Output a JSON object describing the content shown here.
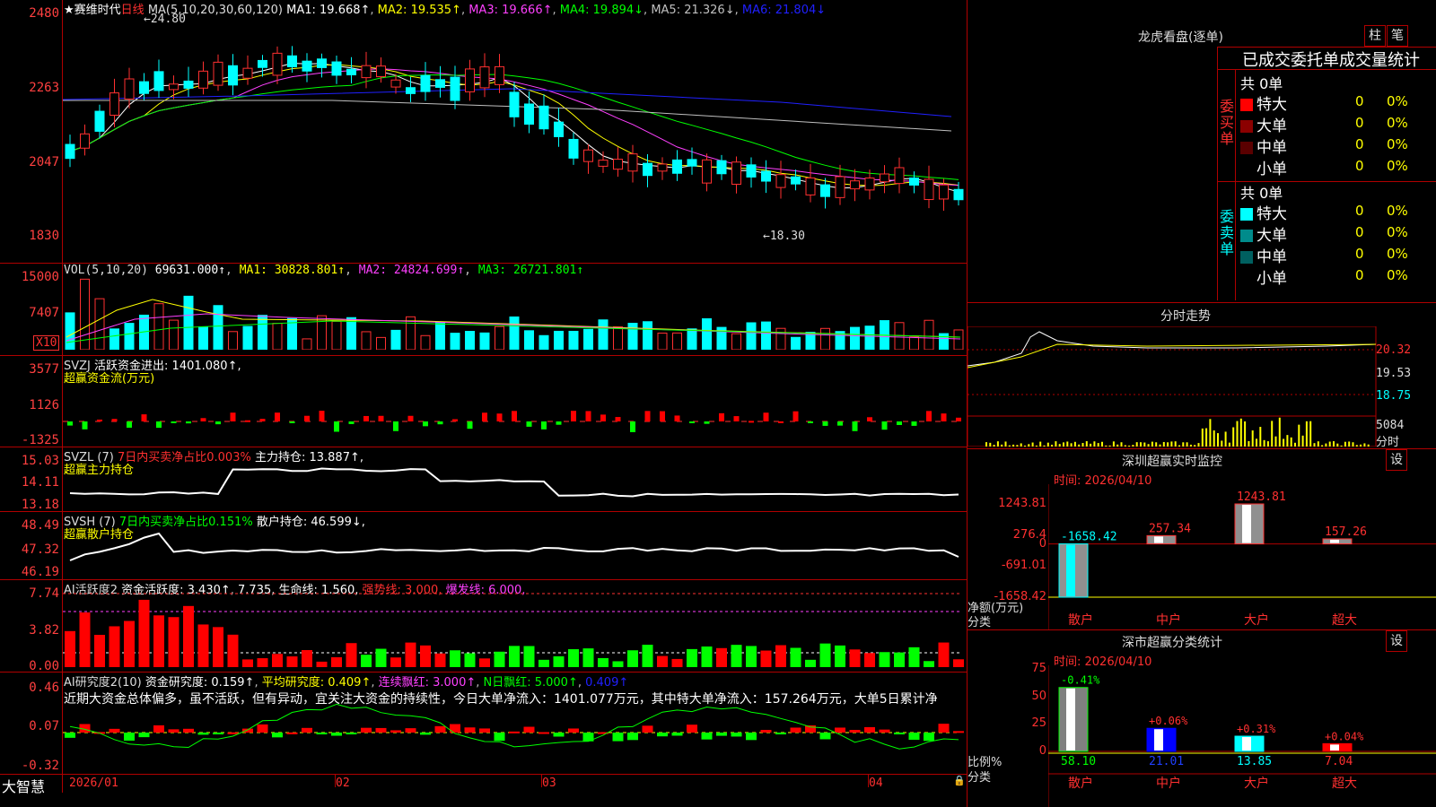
{
  "main": {
    "title_prefix": "★赛维时代",
    "period": "日线",
    "ma_label": "MA(5,10,20,30,60,120)",
    "ma1": "MA1: 19.668↑",
    "ma2": "MA2: 19.535↑",
    "ma3": "MA3: 19.666↑",
    "ma4": "MA4: 19.894↓",
    "ma5": "MA5: 21.326↓",
    "ma6": "MA6: 21.804↓",
    "y_ticks": [
      "2480",
      "2263",
      "2047",
      "1830"
    ],
    "high_marker": "←24.80",
    "low_marker": "←18.30"
  },
  "vol": {
    "title": "VOL(5,10,20)",
    "v": "69631.000↑",
    "ma1": "MA1: 30828.801↑",
    "ma2": "MA2: 24824.699↑",
    "ma3": "MA3: 26721.801↑",
    "y_ticks": [
      "15000",
      "7407"
    ],
    "unit": "X10"
  },
  "svzj": {
    "title": "SVZJ",
    "text": "活跃资金进出: 1401.080↑,",
    "sub": "超赢资金流(万元)",
    "y_ticks": [
      "3577",
      "1126",
      "-1325"
    ]
  },
  "svzl": {
    "title": "SVZL (7)",
    "text1": "7日内买卖净占比0.003%",
    "text2": "主力持仓: 13.887↑,",
    "sub": "超赢主力持仓",
    "y_ticks": [
      "15.03",
      "14.11",
      "13.18"
    ]
  },
  "svsh": {
    "title": "SVSH (7)",
    "text1": "7日内买卖净占比0.151%",
    "text2": "散户持仓: 46.599↓,",
    "sub": "超赢散户持仓",
    "y_ticks": [
      "48.49",
      "47.32",
      "46.19"
    ]
  },
  "ai1": {
    "title": "AI活跃度2",
    "t1": "资金活跃度: 3.430↑",
    "t2": "7.735,",
    "t3": "生命线: 1.560,",
    "t4": "强势线: 3.000,",
    "t5": "爆发线: 6.000,",
    "y_ticks": [
      "7.74",
      "3.82",
      "0.00"
    ]
  },
  "ai2": {
    "title": "AI研究度2(10)",
    "t1": "资金研究度: 0.159↑",
    "t2": "平均研究度: 0.409↑",
    "t3": "连续飘红: 3.000↑",
    "t4": "N日飘红: 5.000↑",
    "t5": "0.409↑",
    "comment": "近期大资金总体偏多，虽不活跃，但有异动，宜关注大资金的持续性，今日大单净流入：1401.077万元，其中特大单净流入：157.264万元，大单5日累计净",
    "y_ticks": [
      "0.46",
      "0.07",
      "-0.32"
    ]
  },
  "x_axis": {
    "labels": [
      "2026/01",
      "02",
      "03",
      "04"
    ],
    "brand": "大智慧"
  },
  "dragon": {
    "title": "龙虎看盘(逐单)",
    "btn1": "柱",
    "btn2": "笔",
    "header": "已成交委托单成交量统计",
    "buy_label": "委买单",
    "sell_label": "委卖单",
    "buy_total": "共 0单",
    "sell_total": "共 0单",
    "buy_rows": [
      {
        "name": "特大",
        "count": "0",
        "pct": "0%",
        "color": "#ff0000"
      },
      {
        "name": "大单",
        "count": "0",
        "pct": "0%",
        "color": "#8b0000"
      },
      {
        "name": "中单",
        "count": "0",
        "pct": "0%",
        "color": "#5a0000"
      },
      {
        "name": "小单",
        "count": "0",
        "pct": "0%",
        "color": "#000000"
      }
    ],
    "sell_rows": [
      {
        "name": "特大",
        "count": "0",
        "pct": "0%",
        "color": "#00ffff"
      },
      {
        "name": "大单",
        "count": "0",
        "pct": "0%",
        "color": "#008b8b"
      },
      {
        "name": "中单",
        "count": "0",
        "pct": "0%",
        "color": "#006060"
      },
      {
        "name": "小单",
        "count": "0",
        "pct": "0%",
        "color": "#000000"
      }
    ]
  },
  "intraday": {
    "title": "分时走势",
    "p1": "20.32",
    "p2": "19.53",
    "p3": "18.75",
    "vol": "5084",
    "vol_unit": "分时"
  },
  "monitor": {
    "title": "深圳超赢实时监控",
    "set": "设",
    "date": "时间: 2026/04/10",
    "y_ticks": [
      "1243.81",
      "276.4",
      "0",
      "-691.01",
      "-1658.42"
    ],
    "ylabel": "净额(万元)",
    "xlabel": "分类",
    "chart_data": {
      "type": "bar",
      "categories": [
        "散户",
        "中户",
        "大户",
        "超大"
      ],
      "values": [
        -1658.42,
        257.34,
        1243.81,
        157.26
      ],
      "value_labels": [
        "-1658.42",
        "257.34",
        "1243.81",
        "157.26"
      ],
      "ylim": [
        -1658.42,
        1243.81
      ]
    }
  },
  "classify": {
    "title": "深市超赢分类统计",
    "set": "设",
    "date": "时间: 2026/04/10",
    "y_ticks": [
      "75",
      "50",
      "25",
      "0"
    ],
    "ylabel": "比例%",
    "xlabel": "分类",
    "chart_data": {
      "type": "bar",
      "categories": [
        "散户",
        "中户",
        "大户",
        "超大"
      ],
      "values": [
        58.1,
        21.01,
        13.85,
        7.04
      ],
      "value_labels": [
        "58.10",
        "21.01",
        "13.85",
        "7.04"
      ],
      "changes": [
        "-0.41%",
        "+0.06%",
        "+0.31%",
        "+0.04%"
      ],
      "ylim": [
        0,
        75
      ]
    }
  }
}
